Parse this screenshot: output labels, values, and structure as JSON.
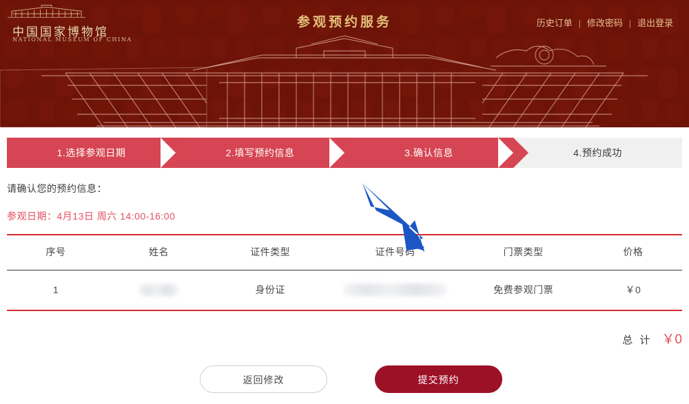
{
  "banner": {
    "logo_cn": "中国国家博物馆",
    "logo_en": "NATIONAL MUSEUM OF CHINA",
    "title": "参观预约服务",
    "nav": [
      {
        "label": "历史订单"
      },
      {
        "label": "修改密码"
      },
      {
        "label": "退出登录"
      }
    ],
    "separator": "|",
    "bg_color": "#6d1308",
    "title_color": "#e3c07a",
    "logo_icon": "museum-building-icon"
  },
  "steps": [
    {
      "label": "1.选择参观日期",
      "state": "active"
    },
    {
      "label": "2.填写预约信息",
      "state": "active"
    },
    {
      "label": "3.确认信息",
      "state": "active"
    },
    {
      "label": "4.预约成功",
      "state": "inactive"
    }
  ],
  "step_colors": {
    "active_bg": "#d64553",
    "active_text": "#ffffff",
    "inactive_bg": "#f0f0f0",
    "inactive_text": "#3a3a3a"
  },
  "main": {
    "confirm_text": "请确认您的预约信息：",
    "visit_date": "参观日期：4月13日 周六 14:00-16:00",
    "visit_date_color": "#e2505f"
  },
  "table": {
    "headers": [
      "序号",
      "姓名",
      "证件类型",
      "证件号码",
      "门票类型",
      "价格"
    ],
    "rows": [
      {
        "index": "1",
        "name": "",
        "name_masked": true,
        "id_type": "身份证",
        "id_number": "",
        "id_number_masked": true,
        "ticket_type": "免费参观门票",
        "price": "￥0"
      }
    ],
    "border_color": "#d42b35"
  },
  "total": {
    "label": "总 计",
    "amount": "￥0",
    "amount_color": "#e2505f"
  },
  "buttons": {
    "back": {
      "label": "返回修改",
      "style": "outline"
    },
    "submit": {
      "label": "提交预约",
      "style": "filled",
      "color": "#9d1127"
    }
  },
  "annotation": {
    "type": "arrow",
    "color": "#1b56c4",
    "points_to": "提交预约"
  }
}
